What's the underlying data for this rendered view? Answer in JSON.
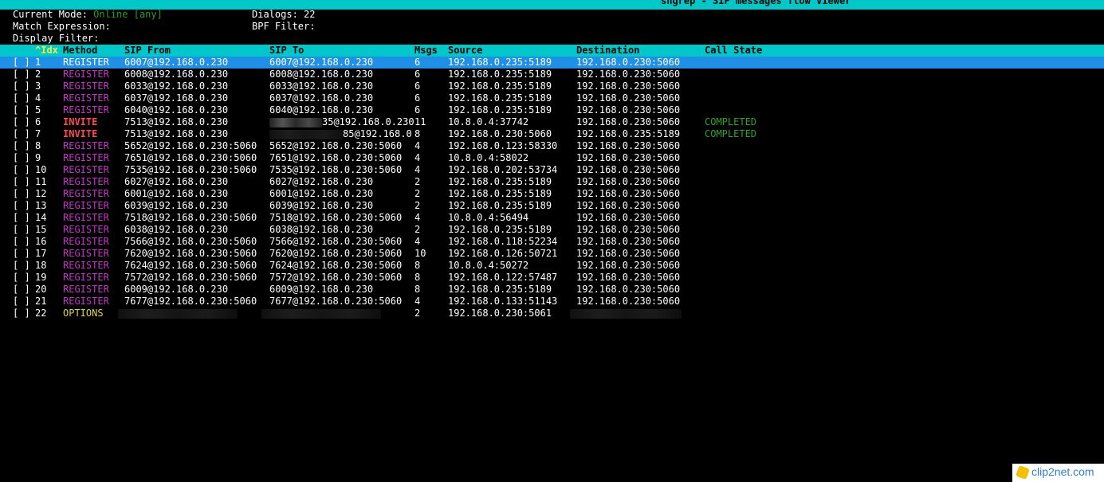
{
  "app": {
    "title": "sngrep - SIP messages flow viewer",
    "bar_color": "#00c8c8"
  },
  "info": {
    "mode_label": "Current Mode:",
    "mode_value": "Online [any]",
    "dialogs_label": "Dialogs:",
    "dialogs_value": "22",
    "match_label": "Match Expression:",
    "bpf_label": "BPF Filter:",
    "display_label": "Display Filter:"
  },
  "table": {
    "columns": {
      "idx": "^Idx",
      "method": "Method",
      "from": "SIP From",
      "to": "SIP To",
      "msgs": "Msgs",
      "source": "Source",
      "destination": "Destination",
      "state": "Call State"
    },
    "checkbox": "[ ]",
    "rows": [
      {
        "idx": "1",
        "method": "REGISTER",
        "from": "6007@192.168.0.230",
        "to": "6007@192.168.0.230",
        "msgs": "6",
        "source": "192.168.0.235:5189",
        "destination": "192.168.0.230:5060",
        "state": ""
      },
      {
        "idx": "2",
        "method": "REGISTER",
        "from": "6008@192.168.0.230",
        "to": "6008@192.168.0.230",
        "msgs": "6",
        "source": "192.168.0.235:5189",
        "destination": "192.168.0.230:5060",
        "state": ""
      },
      {
        "idx": "3",
        "method": "REGISTER",
        "from": "6033@192.168.0.230",
        "to": "6033@192.168.0.230",
        "msgs": "6",
        "source": "192.168.0.235:5189",
        "destination": "192.168.0.230:5060",
        "state": ""
      },
      {
        "idx": "4",
        "method": "REGISTER",
        "from": "6037@192.168.0.230",
        "to": "6037@192.168.0.230",
        "msgs": "6",
        "source": "192.168.0.235:5189",
        "destination": "192.168.0.230:5060",
        "state": ""
      },
      {
        "idx": "5",
        "method": "REGISTER",
        "from": "6040@192.168.0.230",
        "to": "6040@192.168.0.230",
        "msgs": "6",
        "source": "192.168.0.235:5189",
        "destination": "192.168.0.230:5060",
        "state": ""
      },
      {
        "idx": "6",
        "method": "INVITE",
        "from": "7513@192.168.0.230",
        "to": "35@192.168.0.230",
        "msgs": "11",
        "source": "10.8.0.4:37742",
        "destination": "192.168.0.230:5060",
        "state": "COMPLETED"
      },
      {
        "idx": "7",
        "method": "INVITE",
        "from": "7513@192.168.0.230",
        "to": "85@192.168.0",
        "msgs": "8",
        "source": "192.168.0.230:5060",
        "destination": "192.168.0.235:5189",
        "state": "COMPLETED"
      },
      {
        "idx": "8",
        "method": "REGISTER",
        "from": "5652@192.168.0.230:5060",
        "to": "5652@192.168.0.230:5060",
        "msgs": "4",
        "source": "192.168.0.123:58330",
        "destination": "192.168.0.230:5060",
        "state": ""
      },
      {
        "idx": "9",
        "method": "REGISTER",
        "from": "7651@192.168.0.230:5060",
        "to": "7651@192.168.0.230:5060",
        "msgs": "4",
        "source": "10.8.0.4:58022",
        "destination": "192.168.0.230:5060",
        "state": ""
      },
      {
        "idx": "10",
        "method": "REGISTER",
        "from": "7535@192.168.0.230:5060",
        "to": "7535@192.168.0.230:5060",
        "msgs": "4",
        "source": "192.168.0.202:53734",
        "destination": "192.168.0.230:5060",
        "state": ""
      },
      {
        "idx": "11",
        "method": "REGISTER",
        "from": "6027@192.168.0.230",
        "to": "6027@192.168.0.230",
        "msgs": "2",
        "source": "192.168.0.235:5189",
        "destination": "192.168.0.230:5060",
        "state": ""
      },
      {
        "idx": "12",
        "method": "REGISTER",
        "from": "6001@192.168.0.230",
        "to": "6001@192.168.0.230",
        "msgs": "2",
        "source": "192.168.0.235:5189",
        "destination": "192.168.0.230:5060",
        "state": ""
      },
      {
        "idx": "13",
        "method": "REGISTER",
        "from": "6039@192.168.0.230",
        "to": "6039@192.168.0.230",
        "msgs": "2",
        "source": "192.168.0.235:5189",
        "destination": "192.168.0.230:5060",
        "state": ""
      },
      {
        "idx": "14",
        "method": "REGISTER",
        "from": "7518@192.168.0.230:5060",
        "to": "7518@192.168.0.230:5060",
        "msgs": "4",
        "source": "10.8.0.4:56494",
        "destination": "192.168.0.230:5060",
        "state": ""
      },
      {
        "idx": "15",
        "method": "REGISTER",
        "from": "6038@192.168.0.230",
        "to": "6038@192.168.0.230",
        "msgs": "2",
        "source": "192.168.0.235:5189",
        "destination": "192.168.0.230:5060",
        "state": ""
      },
      {
        "idx": "16",
        "method": "REGISTER",
        "from": "7566@192.168.0.230:5060",
        "to": "7566@192.168.0.230:5060",
        "msgs": "4",
        "source": "192.168.0.118:52234",
        "destination": "192.168.0.230:5060",
        "state": ""
      },
      {
        "idx": "17",
        "method": "REGISTER",
        "from": "7620@192.168.0.230:5060",
        "to": "7620@192.168.0.230:5060",
        "msgs": "10",
        "source": "192.168.0.126:50721",
        "destination": "192.168.0.230:5060",
        "state": ""
      },
      {
        "idx": "18",
        "method": "REGISTER",
        "from": "7624@192.168.0.230:5060",
        "to": "7624@192.168.0.230:5060",
        "msgs": "8",
        "source": "10.8.0.4:50272",
        "destination": "192.168.0.230:5060",
        "state": ""
      },
      {
        "idx": "19",
        "method": "REGISTER",
        "from": "7572@192.168.0.230:5060",
        "to": "7572@192.168.0.230:5060",
        "msgs": "8",
        "source": "192.168.0.122:57487",
        "destination": "192.168.0.230:5060",
        "state": ""
      },
      {
        "idx": "20",
        "method": "REGISTER",
        "from": "6009@192.168.0.230",
        "to": "6009@192.168.0.230",
        "msgs": "8",
        "source": "192.168.0.235:5189",
        "destination": "192.168.0.230:5060",
        "state": ""
      },
      {
        "idx": "21",
        "method": "REGISTER",
        "from": "7677@192.168.0.230:5060",
        "to": "7677@192.168.0.230:5060",
        "msgs": "4",
        "source": "192.168.0.133:51143",
        "destination": "192.168.0.230:5060",
        "state": ""
      },
      {
        "idx": "22",
        "method": "OPTIONS",
        "from": "",
        "to": "",
        "msgs": "2",
        "source": "192.168.0.230:5061",
        "destination": "",
        "state": ""
      }
    ]
  },
  "colors": {
    "register": "#c832c8",
    "invite": "#ff4a4a",
    "options": "#e6d23a",
    "completed": "#2aa52a",
    "selected_row": "#1f8fe8"
  },
  "watermark": {
    "text": "clip2net.com"
  }
}
